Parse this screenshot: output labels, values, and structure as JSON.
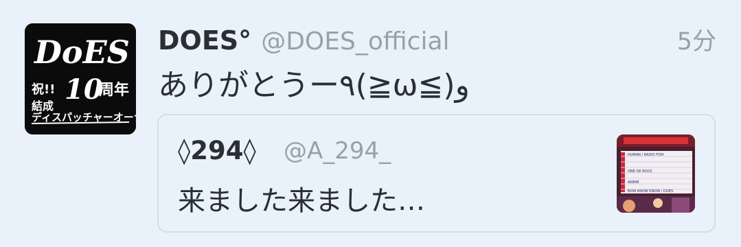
{
  "tweet": {
    "avatar_text": "DoES 祝!! 結成10周年 ディスパッチャーオーナースアンセンス",
    "display_name": "DOES°",
    "handle": "@DOES_official",
    "time": "5分",
    "text": "ありがとうー٩(≧ω≦)و"
  },
  "quote": {
    "display_name": "◊294◊",
    "handle": "@A_294_",
    "text": "来ました来ました…",
    "thumb_lines": [
      "HUMAN / RADIO FISH",
      "ONE OK ROCK",
      "AKB48",
      "BOW KNOW KNOW / DOES"
    ]
  },
  "colors": {
    "background": "#e9f2fb",
    "text": "#292f33",
    "muted": "#98a1a8",
    "border": "#d3dde6"
  }
}
